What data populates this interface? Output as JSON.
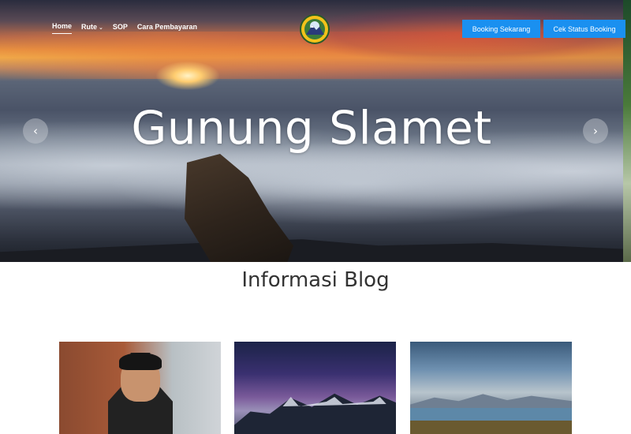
{
  "nav": {
    "items": [
      {
        "label": "Home",
        "active": true
      },
      {
        "label": "Rute",
        "has_dropdown": true
      },
      {
        "label": "SOP"
      },
      {
        "label": "Cara Pembayaran"
      }
    ]
  },
  "header": {
    "logo_icon": "mountain-logo-badge",
    "booking_button": "Booking Sekarang",
    "status_button": "Cek Status Booking",
    "accent_color": "#1a90f0"
  },
  "hero": {
    "title": "Gunung Slamet",
    "prev_icon": "chevron-left-icon",
    "next_icon": "chevron-right-icon"
  },
  "blog": {
    "title": "Informasi Blog",
    "cards": [
      {
        "image": "man-in-leather-jacket-photo"
      },
      {
        "image": "milky-way-over-mountains-photo"
      },
      {
        "image": "mountain-lake-landscape-photo"
      }
    ]
  }
}
